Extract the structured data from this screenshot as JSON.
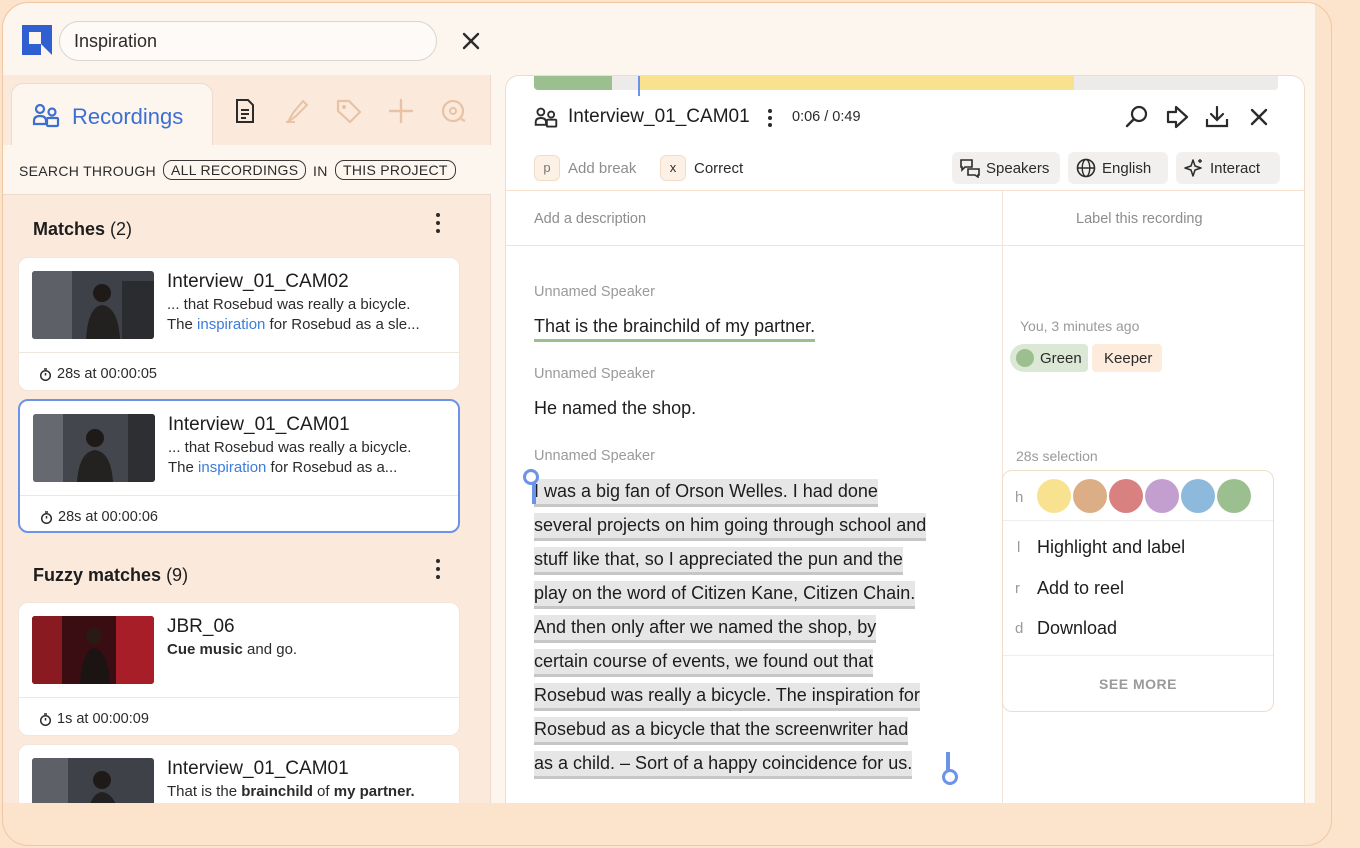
{
  "search": {
    "value": "Inspiration"
  },
  "tabs": {
    "recordings_label": "Recordings"
  },
  "scope": {
    "prefix": "SEARCH THROUGH",
    "all": "ALL RECORDINGS",
    "in": "IN",
    "project": "THIS PROJECT"
  },
  "matches": {
    "title": "Matches",
    "count": "(2)",
    "items": [
      {
        "title": "Interview_01_CAM02",
        "line1": "... that Rosebud was really a bicycle.",
        "line2_pre": "The ",
        "line2_hl": "inspiration",
        "line2_post": " for Rosebud as a sle...",
        "duration": "28s at 00:00:05"
      },
      {
        "title": "Interview_01_CAM01",
        "line1": "... that Rosebud was really a bicycle.",
        "line2_pre": "The ",
        "line2_hl": "inspiration",
        "line2_post": " for Rosebud as a...",
        "duration": "28s at 00:00:06"
      }
    ]
  },
  "fuzzy": {
    "title": "Fuzzy matches",
    "count": "(9)",
    "items": [
      {
        "title": "JBR_06",
        "b1": "Cue music",
        "t1": " and go.",
        "duration": "1s at 00:00:09"
      },
      {
        "title": "Interview_01_CAM01",
        "t0": "That is the ",
        "b1": "brainchild",
        "t1": " of ",
        "b2": "my partner."
      }
    ]
  },
  "recording": {
    "title": "Interview_01_CAM01",
    "time": "0:06 / 0:49"
  },
  "toolbar": {
    "break_key": "p",
    "break_label": "Add break",
    "correct_key": "x",
    "correct_label": "Correct",
    "speakers": "Speakers",
    "language": "English",
    "interact": "Interact"
  },
  "description_placeholder": "Add a description",
  "label_placeholder": "Label this recording",
  "transcript": {
    "speaker": "Unnamed Speaker",
    "u1": "That is the brainchild of my partner.",
    "u2": "He named the shop.",
    "u3_lines": [
      "I was a big fan of Orson Welles. I had done",
      "several projects on him going through school and",
      "stuff like that, so I appreciated the pun and the",
      "play on the word of Citizen Kane, Citizen Chain.",
      "And then only after we named the shop, by",
      "certain course of events, we found out that",
      "Rosebud was really a bicycle. The inspiration for",
      "Rosebud as a bicycle that the screenwriter had",
      "as a child. – Sort of a happy coincidence for us."
    ]
  },
  "annotation": {
    "by": "You, 3 minutes ago",
    "label_green": "Green",
    "label_keeper": "Keeper"
  },
  "selection": {
    "note": "28s selection",
    "h_key": "h",
    "colors": [
      "#f8e28f",
      "#dcae86",
      "#d98081",
      "#c39fcf",
      "#8db9dc",
      "#9cbf8f"
    ],
    "items": [
      {
        "key": "l",
        "label": "Highlight and label"
      },
      {
        "key": "r",
        "label": "Add to reel"
      },
      {
        "key": "d",
        "label": "Download"
      }
    ],
    "see_more": "SEE MORE"
  }
}
